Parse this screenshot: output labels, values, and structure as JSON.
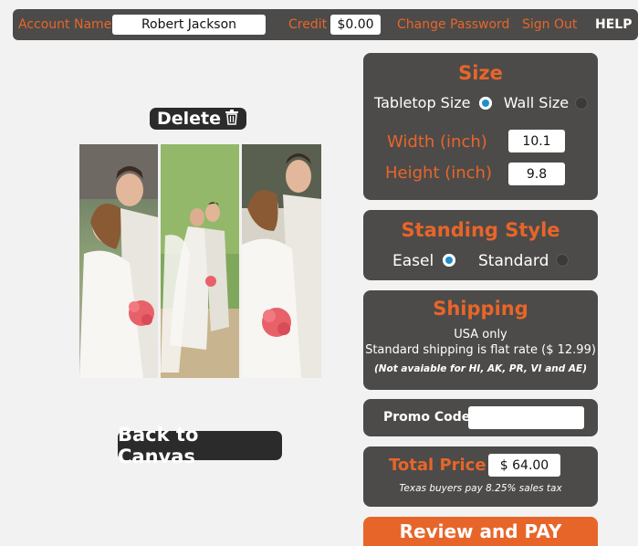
{
  "topbar": {
    "account_label": "Account Name",
    "account_value": "Robert Jackson",
    "credit_label": "Credit",
    "credit_value": "$0.00",
    "change_password": "Change Password",
    "sign_out": "Sign Out",
    "help": "HELP"
  },
  "canvas": {
    "delete_label": "Delete",
    "back_label": "Back to Canvas",
    "delete_icon": "trash-icon"
  },
  "size_panel": {
    "title": "Size",
    "option_tabletop": "Tabletop Size",
    "option_wall": "Wall Size",
    "selected": "Tabletop Size",
    "width_label": "Width (inch)",
    "width_value": "10.1",
    "height_label": "Height (inch)",
    "height_value": "9.8"
  },
  "style_panel": {
    "title": "Standing Style",
    "option_easel": "Easel",
    "option_standard": "Standard",
    "selected": "Easel"
  },
  "shipping_panel": {
    "title": "Shipping",
    "line1": "USA only",
    "line2": "Standard shipping is flat rate ($ 12.99)",
    "note": "(Not avaiable for HI, AK, PR, VI and AE)"
  },
  "promo": {
    "label": "Promo Code",
    "value": ""
  },
  "total": {
    "label": "Total Price",
    "value": "$ 64.00",
    "tax_note": "Texas buyers pay 8.25% sales tax"
  },
  "pay_button": "Review and PAY",
  "colors": {
    "accent": "#e8652a",
    "panel": "#4c4b49",
    "radio_selected": "#1e90c8"
  }
}
